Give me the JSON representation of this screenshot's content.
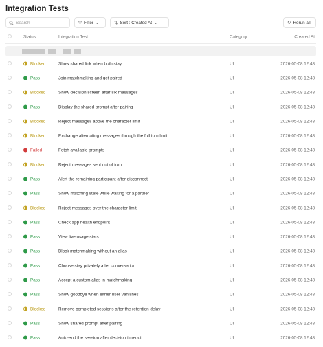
{
  "page": {
    "title": "Integration Tests"
  },
  "toolbar": {
    "search_placeholder": "Search",
    "filter_label": "Filter",
    "sort_label": "Sort : Created At",
    "rerun_label": "Rerun all"
  },
  "table": {
    "headers": {
      "status": "Status",
      "test": "Integration Test",
      "category": "Category",
      "created": "Created At"
    },
    "rows": [
      {
        "status": "Blocked",
        "test": "Show shared link when both stay",
        "category": "UI",
        "created": "2026-05-08 12:48"
      },
      {
        "status": "Pass",
        "test": "Join matchmaking and get paired",
        "category": "UI",
        "created": "2026-05-08 12:48"
      },
      {
        "status": "Blocked",
        "test": "Show decision screen after six messages",
        "category": "UI",
        "created": "2026-05-08 12:48"
      },
      {
        "status": "Pass",
        "test": "Display the shared prompt after pairing",
        "category": "UI",
        "created": "2026-05-08 12:48"
      },
      {
        "status": "Blocked",
        "test": "Reject messages above the character limit",
        "category": "UI",
        "created": "2026-05-08 12:48"
      },
      {
        "status": "Blocked",
        "test": "Exchange alternating messages through the full turn limit",
        "category": "UI",
        "created": "2026-05-08 12:48"
      },
      {
        "status": "Failed",
        "test": "Fetch available prompts",
        "category": "UI",
        "created": "2026-05-08 12:48"
      },
      {
        "status": "Blocked",
        "test": "Reject messages sent out of turn",
        "category": "UI",
        "created": "2026-05-08 12:48"
      },
      {
        "status": "Pass",
        "test": "Alert the remaining participant after disconnect",
        "category": "UI",
        "created": "2026-05-08 12:48"
      },
      {
        "status": "Pass",
        "test": "Show matching state while waiting for a partner",
        "category": "UI",
        "created": "2026-05-08 12:48"
      },
      {
        "status": "Blocked",
        "test": "Reject messages over the character limit",
        "category": "UI",
        "created": "2026-05-08 12:48"
      },
      {
        "status": "Pass",
        "test": "Check app health endpoint",
        "category": "UI",
        "created": "2026-05-08 12:48"
      },
      {
        "status": "Pass",
        "test": "View live usage stats",
        "category": "UI",
        "created": "2026-05-08 12:48"
      },
      {
        "status": "Pass",
        "test": "Block matchmaking without an alias",
        "category": "UI",
        "created": "2026-05-08 12:48"
      },
      {
        "status": "Pass",
        "test": "Choose stay privately after conversation",
        "category": "UI",
        "created": "2026-05-08 12:48"
      },
      {
        "status": "Pass",
        "test": "Accept a custom alias in matchmaking",
        "category": "UI",
        "created": "2026-05-08 12:48"
      },
      {
        "status": "Pass",
        "test": "Show goodbye when either user vanishes",
        "category": "UI",
        "created": "2026-05-08 12:48"
      },
      {
        "status": "Blocked",
        "test": "Remove completed sessions after the retention delay",
        "category": "UI",
        "created": "2026-05-08 12:48"
      },
      {
        "status": "Pass",
        "test": "Show shared prompt after pairing",
        "category": "UI",
        "created": "2026-05-08 12:48"
      },
      {
        "status": "Pass",
        "test": "Auto-end the session after decision timeout",
        "category": "UI",
        "created": "2026-05-08 12:48"
      }
    ]
  },
  "colors": {
    "pass": "#2e9a48",
    "failed": "#d23b3b",
    "blocked": "#c2a220"
  },
  "icons": {
    "search": "search-icon",
    "filter": "filter-icon",
    "sort": "sort-icon",
    "rerun": "refresh-icon"
  }
}
